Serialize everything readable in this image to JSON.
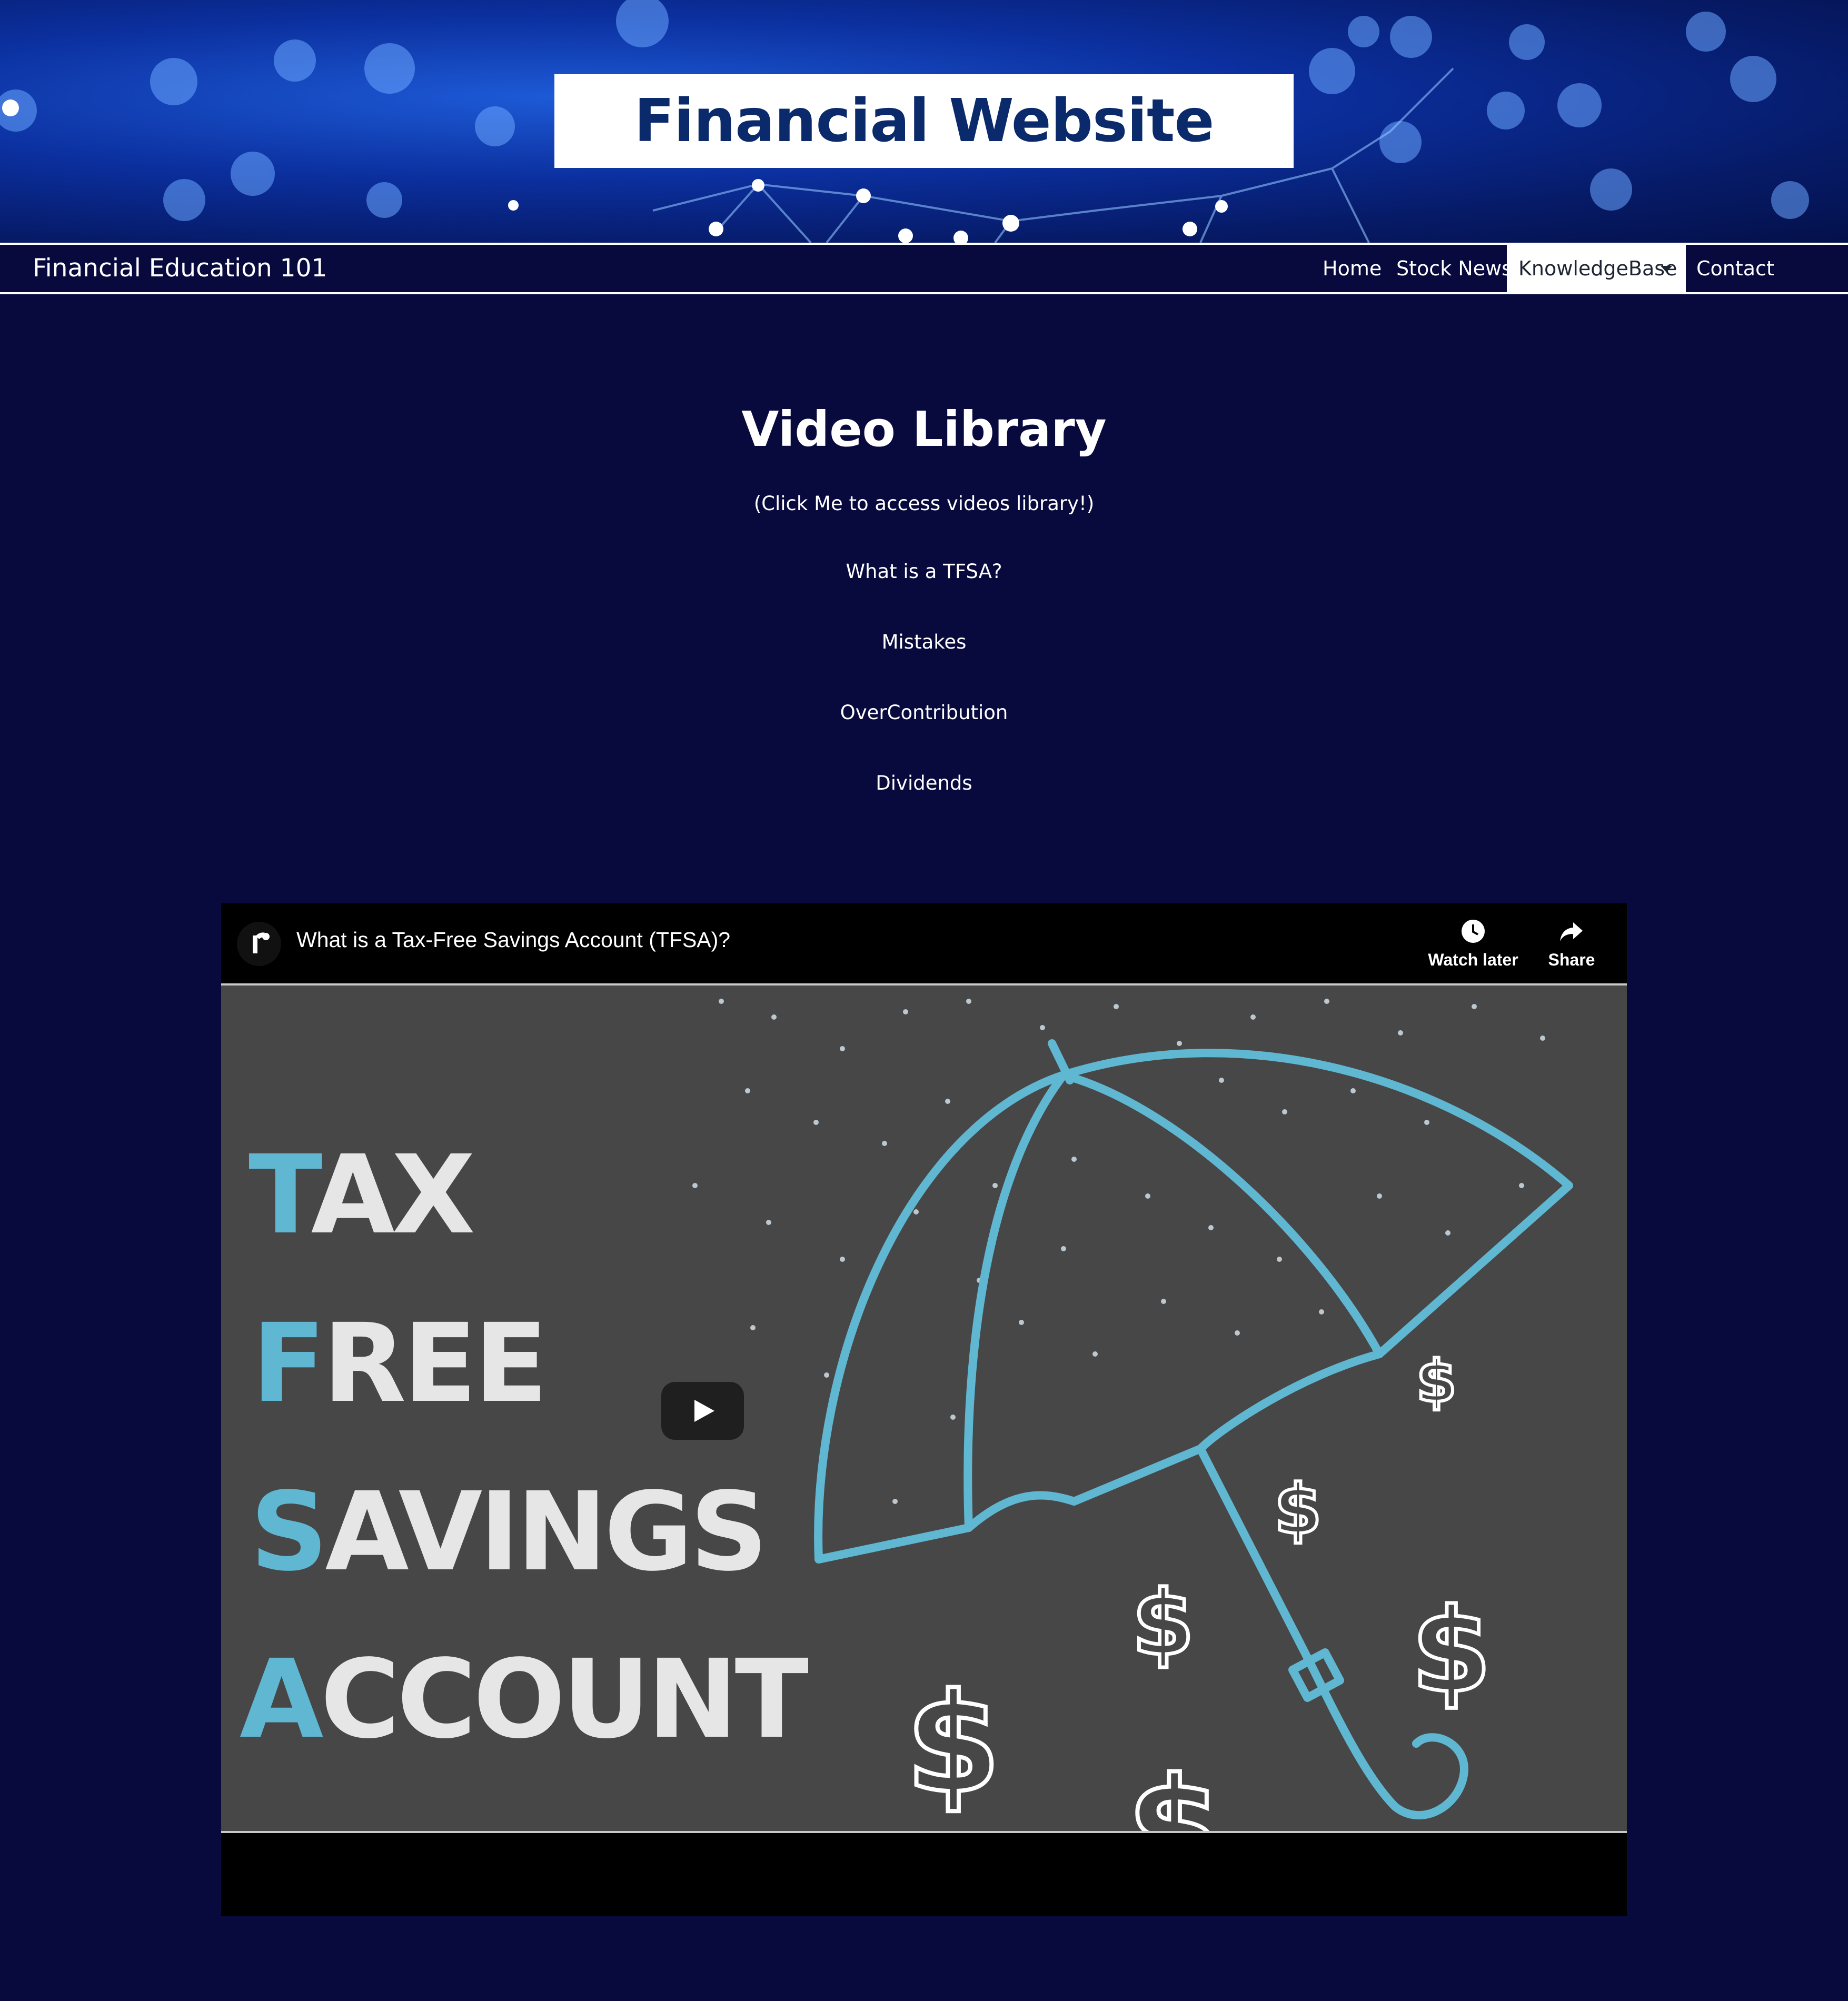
{
  "hero": {
    "title": "Financial Website"
  },
  "navbar": {
    "brand": "Financial Education 101",
    "items": [
      {
        "label": "Home"
      },
      {
        "label": "Stock News"
      },
      {
        "label": "KnowledgeBase",
        "active": true,
        "dropdown": true
      },
      {
        "label": "Contact"
      }
    ]
  },
  "library": {
    "title": "Video Library",
    "subtitle": "(Click Me to access videos library!)",
    "links": [
      "What is a TFSA?",
      "Mistakes",
      "OverContribution",
      "Dividends"
    ]
  },
  "video": {
    "title": "What is a Tax-Free Savings Account (TFSA)?",
    "watch_later": "Watch later",
    "share": "Share",
    "thumbnail_words": [
      "TAX",
      "FREE",
      "SAVINGS",
      "ACCOUNT"
    ]
  },
  "colors": {
    "page_bg": "#080a3e",
    "hero_title": "#0a2a6b",
    "accent_teal": "#5fb7d2",
    "thumb_bg": "#474747"
  }
}
